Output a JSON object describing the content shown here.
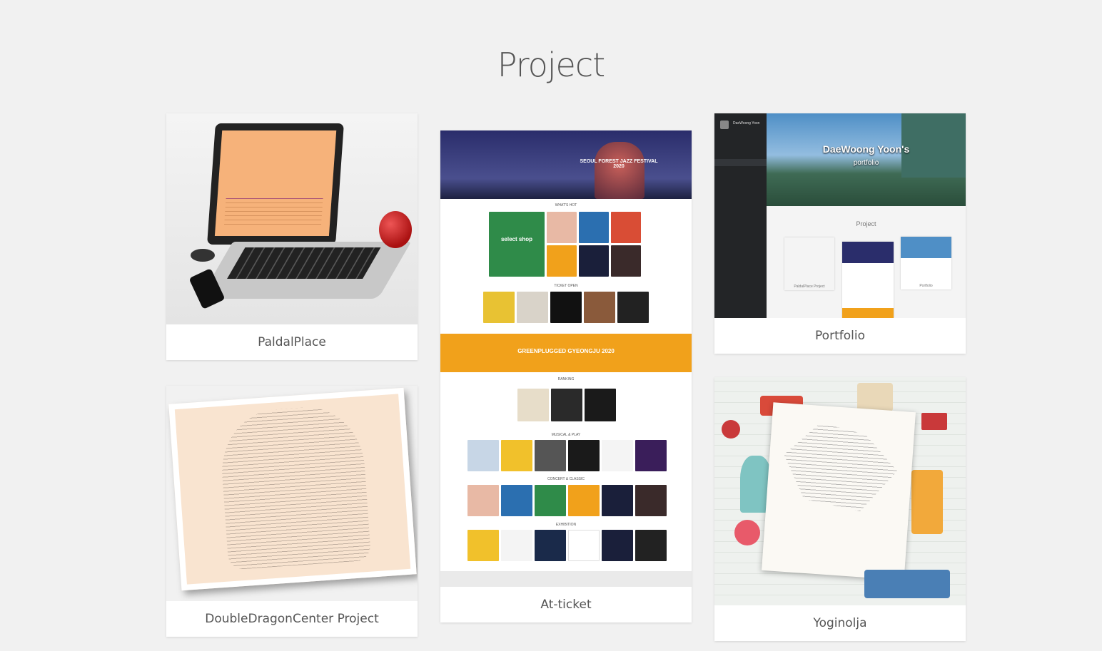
{
  "page": {
    "title": "Project"
  },
  "projects": [
    {
      "caption": "PaldalPlace",
      "thumb_icon": "laptop-ascii-cup-icon"
    },
    {
      "caption": "At-ticket",
      "thumb_icon": "ticket-site-screenshot-icon",
      "thumb_text": {
        "whats_hot": "WHAT'S HOT",
        "ticket_open": "TICKET OPEN",
        "banner": "GREENPLUGGED GYEONGJU 2020",
        "ranking": "RANKING",
        "musical": "MUSICAL & PLAY",
        "concert": "CONCERT & CLASSIC",
        "exhibition": "EXHIBITION",
        "hero": "SEOUL FOREST JAZZ FESTIVAL 2020",
        "select_shop": "select shop"
      }
    },
    {
      "caption": "Portfolio",
      "thumb_icon": "portfolio-site-screenshot-icon",
      "thumb_text": {
        "hero_title": "DaeWoong Yoon's",
        "hero_sub": "portfolio",
        "section": "Project",
        "mini_1": "PaldalPlace Project",
        "mini_3": "Portfolio",
        "user": "DaeWoong Yoon"
      }
    },
    {
      "caption": "DoubleDragonCenter Project",
      "thumb_icon": "ascii-dragon-paper-icon"
    },
    {
      "caption": "Yoginolja",
      "thumb_icon": "ascii-map-travel-icon"
    }
  ],
  "colors": {
    "background": "#f1f1f1",
    "card": "#ffffff",
    "caption_text": "#555555",
    "title_text": "#555555"
  }
}
